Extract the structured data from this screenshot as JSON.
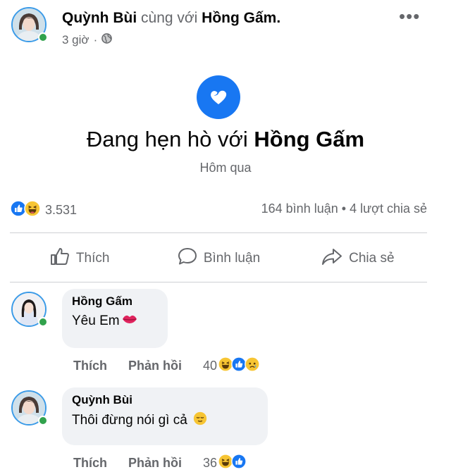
{
  "post": {
    "author": "Quỳnh Bùi",
    "with_text": "cùng với",
    "tagged": "Hồng Gấm.",
    "time": "3 giờ",
    "separator": "·",
    "more_label": "•••"
  },
  "life_event": {
    "title_prefix": "Đang hẹn hò với",
    "partner": "Hồng Gấm",
    "date": "Hôm qua"
  },
  "stats": {
    "reaction_count": "3.531",
    "comments": "164 bình luận",
    "dot": "•",
    "shares": "4 lượt chia sẻ"
  },
  "actions": {
    "like": "Thích",
    "comment": "Bình luận",
    "share": "Chia sẻ"
  },
  "comments": [
    {
      "name": "Hồng Gấm",
      "text": "Yêu Em",
      "like": "Thích",
      "reply": "Phản hồi",
      "reactions": "40"
    },
    {
      "name": "Quỳnh Bùi",
      "text": "Thôi đừng nói gì cả",
      "like": "Thích",
      "reply": "Phản hồi",
      "reactions": "36"
    }
  ],
  "colors": {
    "brand_blue": "#1877f2",
    "online_green": "#31a24c",
    "secondary_text": "#65676b",
    "bubble_bg": "#f0f2f5"
  },
  "icons": [
    "globe-icon",
    "heart-icon",
    "like-reaction-icon",
    "haha-reaction-icon",
    "sad-reaction-icon",
    "kiss-icon",
    "relieved-face-icon",
    "thumbs-up-icon",
    "comment-icon",
    "share-icon",
    "more-icon"
  ]
}
